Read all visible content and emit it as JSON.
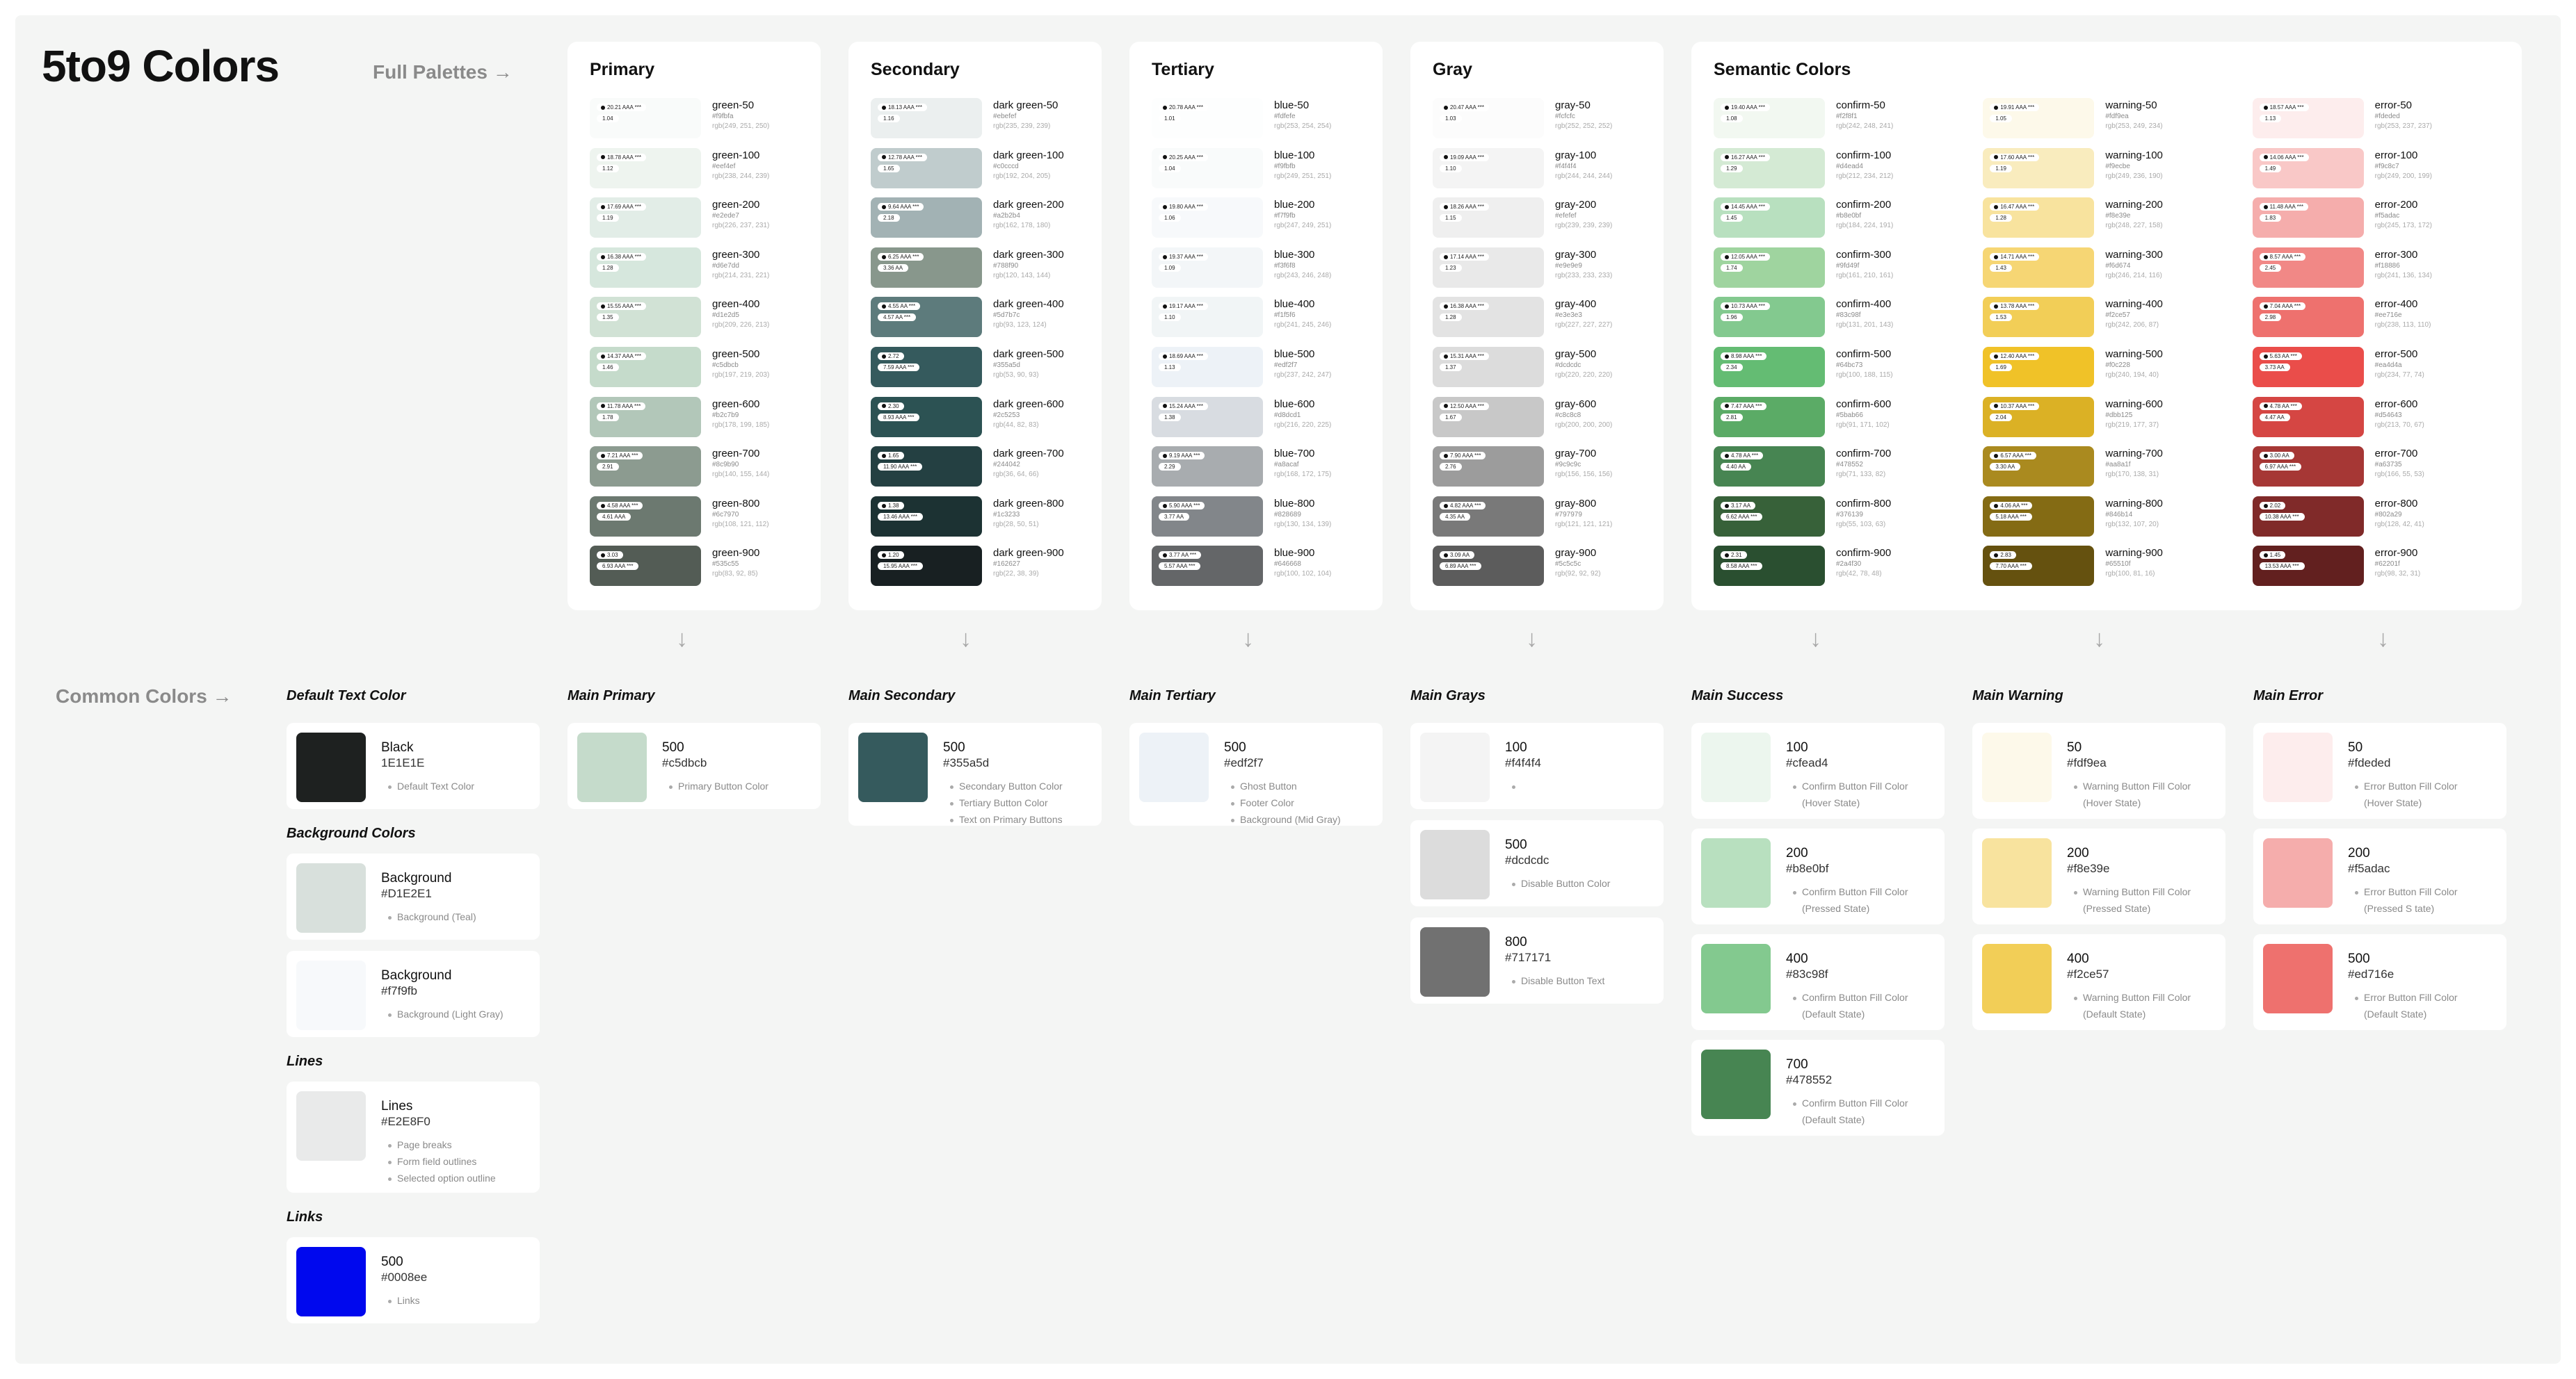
{
  "header": {
    "title": "5to9 Colors",
    "full_palettes": "Full Palettes →",
    "common_colors": "Common Colors →"
  },
  "palettes": [
    {
      "title": "Primary",
      "rows": [
        {
          "name": "green-50",
          "hex": "#f9fbfa",
          "rgb": "rgb(249, 251, 250)",
          "c": "#f9fbfa",
          "p1": "20.21 AAA ***",
          "p2": "1.04"
        },
        {
          "name": "green-100",
          "hex": "#eef4ef",
          "rgb": "rgb(238, 244, 239)",
          "c": "#eef4ef",
          "p1": "18.78 AAA ***",
          "p2": "1.12"
        },
        {
          "name": "green-200",
          "hex": "#e2ede7",
          "rgb": "rgb(226, 237, 231)",
          "c": "#e2ede7",
          "p1": "17.69 AAA ***",
          "p2": "1.19"
        },
        {
          "name": "green-300",
          "hex": "#d6e7dd",
          "rgb": "rgb(214, 231, 221)",
          "c": "#d6e7dd",
          "p1": "16.38 AAA ***",
          "p2": "1.28"
        },
        {
          "name": "green-400",
          "hex": "#d1e2d5",
          "rgb": "rgb(209, 226, 213)",
          "c": "#d1e2d5",
          "p1": "15.55 AAA ***",
          "p2": "1.35"
        },
        {
          "name": "green-500",
          "hex": "#c5dbcb",
          "rgb": "rgb(197, 219, 203)",
          "c": "#c5dbcb",
          "p1": "14.37 AAA ***",
          "p2": "1.46"
        },
        {
          "name": "green-600",
          "hex": "#b2c7b9",
          "rgb": "rgb(178, 199, 185)",
          "c": "#b2c7b9",
          "p1": "11.78 AAA ***",
          "p2": "1.78"
        },
        {
          "name": "green-700",
          "hex": "#8c9b90",
          "rgb": "rgb(140, 155, 144)",
          "c": "#8c9b90",
          "p1": "7.21 AAA ***",
          "p2": "2.91"
        },
        {
          "name": "green-800",
          "hex": "#6c7970",
          "rgb": "rgb(108, 121, 112)",
          "c": "#6c7970",
          "p1": "4.58 AAA ***",
          "p2": "4.61 AAA"
        },
        {
          "name": "green-900",
          "hex": "#535c55",
          "rgb": "rgb(83, 92, 85)",
          "c": "#535c55",
          "p1": "3.03",
          "p2": "6.93 AAA ***"
        }
      ]
    },
    {
      "title": "Secondary",
      "rows": [
        {
          "name": "dark green-50",
          "hex": "#ebefef",
          "rgb": "rgb(235, 239, 239)",
          "c": "#ebefef",
          "p1": "18.13 AAA ***",
          "p2": "1.16"
        },
        {
          "name": "dark green-100",
          "hex": "#c0cccd",
          "rgb": "rgb(192, 204, 205)",
          "c": "#c0cccd",
          "p1": "12.78 AAA ***",
          "p2": "1.65"
        },
        {
          "name": "dark green-200",
          "hex": "#a2b2b4",
          "rgb": "rgb(162, 178, 180)",
          "c": "#a2b2b4",
          "p1": "9.64 AAA ***",
          "p2": "2.18"
        },
        {
          "name": "dark green-300",
          "hex": "#788f90",
          "rgb": "rgb(120, 143, 144)",
          "c": "#88978c",
          "p1": "6.25 AAA ***",
          "p2": "3.36 AA"
        },
        {
          "name": "dark green-400",
          "hex": "#5d7b7c",
          "rgb": "rgb(93, 123, 124)",
          "c": "#5d7b7c",
          "p1": "4.55 AA ***",
          "p2": "4.57 AA ***"
        },
        {
          "name": "dark green-500",
          "hex": "#355a5d",
          "rgb": "rgb(53, 90, 93)",
          "c": "#355a5d",
          "p1": "2.72",
          "p2": "7.59 AAA ***"
        },
        {
          "name": "dark green-600",
          "hex": "#2c5253",
          "rgb": "rgb(44, 82, 83)",
          "c": "#2c5253",
          "p1": "2.30",
          "p2": "8.93 AAA ***"
        },
        {
          "name": "dark green-700",
          "hex": "#244042",
          "rgb": "rgb(36, 64, 66)",
          "c": "#244042",
          "p1": "1.65",
          "p2": "11.90 AAA ***"
        },
        {
          "name": "dark green-800",
          "hex": "#1c3233",
          "rgb": "rgb(28, 50, 51)",
          "c": "#1c3233",
          "p1": "1.38",
          "p2": "13.46 AAA ***"
        },
        {
          "name": "dark green-900",
          "hex": "#162627",
          "rgb": "rgb(22, 38, 39)",
          "c": "#182022",
          "p1": "1.20",
          "p2": "15.95 AAA ***"
        }
      ]
    },
    {
      "title": "Tertiary",
      "rows": [
        {
          "name": "blue-50",
          "hex": "#fdfefe",
          "rgb": "rgb(253, 254, 254)",
          "c": "#fdfefe",
          "p1": "20.78 AAA ***",
          "p2": "1.01"
        },
        {
          "name": "blue-100",
          "hex": "#f9fbfb",
          "rgb": "rgb(249, 251, 251)",
          "c": "#f9fbfb",
          "p1": "20.25 AAA ***",
          "p2": "1.04"
        },
        {
          "name": "blue-200",
          "hex": "#f7f9fb",
          "rgb": "rgb(247, 249, 251)",
          "c": "#f7f9fb",
          "p1": "19.80 AAA ***",
          "p2": "1.06"
        },
        {
          "name": "blue-300",
          "hex": "#f3f6f8",
          "rgb": "rgb(243, 246, 248)",
          "c": "#f3f6f8",
          "p1": "19.37 AAA ***",
          "p2": "1.09"
        },
        {
          "name": "blue-400",
          "hex": "#f1f5f6",
          "rgb": "rgb(241, 245, 246)",
          "c": "#f1f5f6",
          "p1": "19.17 AAA ***",
          "p2": "1.10"
        },
        {
          "name": "blue-500",
          "hex": "#edf2f7",
          "rgb": "rgb(237, 242, 247)",
          "c": "#edf2f7",
          "p1": "18.69 AAA ***",
          "p2": "1.13"
        },
        {
          "name": "blue-600",
          "hex": "#d8dcd1",
          "rgb": "rgb(216, 220, 225)",
          "c": "#d8dce1",
          "p1": "15.24 AAA ***",
          "p2": "1.38"
        },
        {
          "name": "blue-700",
          "hex": "#a8acaf",
          "rgb": "rgb(168, 172, 175)",
          "c": "#a8acaf",
          "p1": "9.19 AAA ***",
          "p2": "2.29"
        },
        {
          "name": "blue-800",
          "hex": "#828689",
          "rgb": "rgb(130, 134, 139)",
          "c": "#82868a",
          "p1": "5.90 AAA ***",
          "p2": "3.77 AA"
        },
        {
          "name": "blue-900",
          "hex": "#646668",
          "rgb": "rgb(100, 102, 104)",
          "c": "#646668",
          "p1": "3.77 AA ***",
          "p2": "5.57 AAA ***"
        }
      ]
    },
    {
      "title": "Gray",
      "rows": [
        {
          "name": "gray-50",
          "hex": "#fcfcfc",
          "rgb": "rgb(252, 252, 252)",
          "c": "#fcfcfc",
          "p1": "20.47 AAA ***",
          "p2": "1.03"
        },
        {
          "name": "gray-100",
          "hex": "#f4f4f4",
          "rgb": "rgb(244, 244, 244)",
          "c": "#f4f4f4",
          "p1": "19.09 AAA ***",
          "p2": "1.10"
        },
        {
          "name": "gray-200",
          "hex": "#efefef",
          "rgb": "rgb(239, 239, 239)",
          "c": "#efefef",
          "p1": "18.26 AAA ***",
          "p2": "1.15"
        },
        {
          "name": "gray-300",
          "hex": "#e9e9e9",
          "rgb": "rgb(233, 233, 233)",
          "c": "#e9e9e9",
          "p1": "17.14 AAA ***",
          "p2": "1.23"
        },
        {
          "name": "gray-400",
          "hex": "#e3e3e3",
          "rgb": "rgb(227, 227, 227)",
          "c": "#e3e3e3",
          "p1": "16.38 AAA ***",
          "p2": "1.28"
        },
        {
          "name": "gray-500",
          "hex": "#dcdcdc",
          "rgb": "rgb(220, 220, 220)",
          "c": "#dcdcdc",
          "p1": "15.31 AAA ***",
          "p2": "1.37"
        },
        {
          "name": "gray-600",
          "hex": "#c8c8c8",
          "rgb": "rgb(200, 200, 200)",
          "c": "#c8c8c8",
          "p1": "12.50 AAA ***",
          "p2": "1.67"
        },
        {
          "name": "gray-700",
          "hex": "#9c9c9c",
          "rgb": "rgb(156, 156, 156)",
          "c": "#9c9c9c",
          "p1": "7.90 AAA ***",
          "p2": "2.76"
        },
        {
          "name": "gray-800",
          "hex": "#797979",
          "rgb": "rgb(121, 121, 121)",
          "c": "#797979",
          "p1": "4.82 AAA ***",
          "p2": "4.35 AA"
        },
        {
          "name": "gray-900",
          "hex": "#5c5c5c",
          "rgb": "rgb(92, 92, 92)",
          "c": "#5c5c5c",
          "p1": "3.09 AA",
          "p2": "6.89 AAA ***"
        }
      ]
    }
  ],
  "semantic": {
    "title": "Semantic Colors",
    "columns": [
      [
        {
          "name": "confirm-50",
          "hex": "#f2f8f1",
          "rgb": "rgb(242, 248, 241)",
          "c": "#f2f8f1",
          "p1": "19.40 AAA ***",
          "p2": "1.08"
        },
        {
          "name": "confirm-100",
          "hex": "#d4ead4",
          "rgb": "rgb(212, 234, 212)",
          "c": "#d4ead4",
          "p1": "16.27 AAA ***",
          "p2": "1.29"
        },
        {
          "name": "confirm-200",
          "hex": "#b8e0bf",
          "rgb": "rgb(184, 224, 191)",
          "c": "#b8e0bf",
          "p1": "14.45 AAA ***",
          "p2": "1.45"
        },
        {
          "name": "confirm-300",
          "hex": "#9fd49f",
          "rgb": "rgb(161, 210, 161)",
          "c": "#9fd49f",
          "p1": "12.05 AAA ***",
          "p2": "1.74"
        },
        {
          "name": "confirm-400",
          "hex": "#83c98f",
          "rgb": "rgb(131, 201, 143)",
          "c": "#83c98f",
          "p1": "10.73 AAA ***",
          "p2": "1.96"
        },
        {
          "name": "confirm-500",
          "hex": "#64bc73",
          "rgb": "rgb(100, 188, 115)",
          "c": "#64bc73",
          "p1": "8.98 AAA ***",
          "p2": "2.34"
        },
        {
          "name": "confirm-600",
          "hex": "#5bab66",
          "rgb": "rgb(91, 171, 102)",
          "c": "#5bab66",
          "p1": "7.47 AAA ***",
          "p2": "2.81"
        },
        {
          "name": "confirm-700",
          "hex": "#478552",
          "rgb": "rgb(71, 133, 82)",
          "c": "#478552",
          "p1": "4.78 AA ***",
          "p2": "4.40 AA"
        },
        {
          "name": "confirm-800",
          "hex": "#376139",
          "rgb": "rgb(55, 103, 63)",
          "c": "#376139",
          "p1": "3.17 AA",
          "p2": "6.62 AAA ***"
        },
        {
          "name": "confirm-900",
          "hex": "#2a4f30",
          "rgb": "rgb(42, 78, 48)",
          "c": "#2a4f30",
          "p1": "2.31",
          "p2": "8.58 AAA ***"
        }
      ],
      [
        {
          "name": "warning-50",
          "hex": "#fdf9ea",
          "rgb": "rgb(253, 249, 234)",
          "c": "#fdf9ea",
          "p1": "19.91 AAA ***",
          "p2": "1.05"
        },
        {
          "name": "warning-100",
          "hex": "#f9ecbe",
          "rgb": "rgb(249, 236, 190)",
          "c": "#f9ecbe",
          "p1": "17.60 AAA ***",
          "p2": "1.19"
        },
        {
          "name": "warning-200",
          "hex": "#f8e39e",
          "rgb": "rgb(248, 227, 158)",
          "c": "#f8e39e",
          "p1": "16.47 AAA ***",
          "p2": "1.28"
        },
        {
          "name": "warning-300",
          "hex": "#f6d674",
          "rgb": "rgb(246, 214, 116)",
          "c": "#f6d674",
          "p1": "14.71 AAA ***",
          "p2": "1.43"
        },
        {
          "name": "warning-400",
          "hex": "#f2ce57",
          "rgb": "rgb(242, 206, 87)",
          "c": "#f2ce57",
          "p1": "13.78 AAA ***",
          "p2": "1.53"
        },
        {
          "name": "warning-500",
          "hex": "#f0c228",
          "rgb": "rgb(240, 194, 40)",
          "c": "#f0c228",
          "p1": "12.40 AAA ***",
          "p2": "1.69"
        },
        {
          "name": "warning-600",
          "hex": "#dbb125",
          "rgb": "rgb(219, 177, 37)",
          "c": "#dbb125",
          "p1": "10.37 AAA ***",
          "p2": "2.04"
        },
        {
          "name": "warning-700",
          "hex": "#aa8a1f",
          "rgb": "rgb(170, 138, 31)",
          "c": "#aa8a1f",
          "p1": "6.57 AAA ***",
          "p2": "3.30 AA"
        },
        {
          "name": "warning-800",
          "hex": "#846b14",
          "rgb": "rgb(132, 107, 20)",
          "c": "#846b14",
          "p1": "4.06 AA ***",
          "p2": "5.18 AAA ***"
        },
        {
          "name": "warning-900",
          "hex": "#65510f",
          "rgb": "rgb(100, 81, 16)",
          "c": "#65510f",
          "p1": "2.83",
          "p2": "7.70 AAA ***"
        }
      ],
      [
        {
          "name": "error-50",
          "hex": "#fdeded",
          "rgb": "rgb(253, 237, 237)",
          "c": "#fdeded",
          "p1": "18.57 AAA ***",
          "p2": "1.13"
        },
        {
          "name": "error-100",
          "hex": "#f9c8c7",
          "rgb": "rgb(249, 200, 199)",
          "c": "#f9c8c7",
          "p1": "14.06 AAA ***",
          "p2": "1.49"
        },
        {
          "name": "error-200",
          "hex": "#f5adac",
          "rgb": "rgb(245, 173, 172)",
          "c": "#f5adac",
          "p1": "11.48 AAA ***",
          "p2": "1.83"
        },
        {
          "name": "error-300",
          "hex": "#f18886",
          "rgb": "rgb(241, 136, 134)",
          "c": "#f18886",
          "p1": "8.57 AAA ***",
          "p2": "2.45"
        },
        {
          "name": "error-400",
          "hex": "#ee716e",
          "rgb": "rgb(238, 113, 110)",
          "c": "#ee716e",
          "p1": "7.04 AAA ***",
          "p2": "2.98"
        },
        {
          "name": "error-500",
          "hex": "#ea4d4a",
          "rgb": "rgb(234, 77, 74)",
          "c": "#ea4d4a",
          "p1": "5.63 AA ***",
          "p2": "3.73 AA"
        },
        {
          "name": "error-600",
          "hex": "#d54643",
          "rgb": "rgb(213, 70, 67)",
          "c": "#d54643",
          "p1": "4.78 AA ***",
          "p2": "4.47 AA"
        },
        {
          "name": "error-700",
          "hex": "#a63735",
          "rgb": "rgb(166, 55, 53)",
          "c": "#a63735",
          "p1": "3.00 AA",
          "p2": "6.97 AAA ***"
        },
        {
          "name": "error-800",
          "hex": "#802a29",
          "rgb": "rgb(128, 42, 41)",
          "c": "#802a29",
          "p1": "2.02",
          "p2": "10.38 AAA ***"
        },
        {
          "name": "error-900",
          "hex": "#62201f",
          "rgb": "rgb(98, 32, 31)",
          "c": "#62201f",
          "p1": "1.45",
          "p2": "13.53 AAA ***"
        }
      ]
    ]
  },
  "common": {
    "default_text": {
      "label": "Default Text Color",
      "cards": [
        {
          "name": "Black",
          "hex": "1E1E1E",
          "c": "#1e2120",
          "notes": [
            "Default Text Color"
          ]
        }
      ]
    },
    "background": {
      "label": "Background Colors",
      "cards": [
        {
          "name": "Background",
          "hex": "#D1E2E1",
          "c": "#d8e0dc",
          "notes": [
            "Background (Teal)"
          ]
        },
        {
          "name": "Background",
          "hex": "#f7f9fb",
          "c": "#f7f9fb",
          "notes": [
            "Background (Light Gray)"
          ]
        }
      ]
    },
    "lines": {
      "label": "Lines",
      "cards": [
        {
          "name": "Lines",
          "hex": "#E2E8F0",
          "c": "#e9eaea",
          "notes": [
            "Page breaks",
            "Form field outlines",
            "Selected option outline"
          ]
        }
      ]
    },
    "links": {
      "label": "Links",
      "cards": [
        {
          "name": "500",
          "hex": "#0008ee",
          "c": "#0008ee",
          "notes": [
            "Links"
          ]
        }
      ]
    },
    "groups": [
      {
        "label": "Main Primary",
        "cards": [
          {
            "name": "500",
            "hex": "#c5dbcb",
            "c": "#c5dbcb",
            "notes": [
              "Primary Button Color"
            ]
          }
        ]
      },
      {
        "label": "Main Secondary",
        "cards": [
          {
            "name": "500",
            "hex": "#355a5d",
            "c": "#355a5d",
            "notes": [
              "Secondary Button Color",
              "Tertiary Button Color",
              "Text on Primary Buttons"
            ]
          }
        ]
      },
      {
        "label": "Main Tertiary",
        "cards": [
          {
            "name": "500",
            "hex": "#edf2f7",
            "c": "#edf2f7",
            "notes": [
              "Ghost Button",
              "Footer Color",
              "Background (Mid Gray)"
            ]
          }
        ]
      },
      {
        "label": "Main Grays",
        "cards": [
          {
            "name": "100",
            "hex": "#f4f4f4",
            "c": "#f4f4f4",
            "notes": [
              ""
            ]
          },
          {
            "name": "500",
            "hex": "#dcdcdc",
            "c": "#dcdcdc",
            "notes": [
              "Disable Button Color"
            ]
          },
          {
            "name": "800",
            "hex": "#717171",
            "c": "#717171",
            "notes": [
              "Disable Button Text"
            ]
          }
        ]
      },
      {
        "label": "Main Success",
        "cards": [
          {
            "name": "100",
            "hex": "#cfead4",
            "c": "#ecf6ee",
            "notes": [
              "Confirm Button Fill Color",
              "(Hover State)"
            ]
          },
          {
            "name": "200",
            "hex": "#b8e0bf",
            "c": "#b8e0bf",
            "notes": [
              "Confirm Button Fill Color",
              "(Pressed State)"
            ]
          },
          {
            "name": "400",
            "hex": "#83c98f",
            "c": "#83c98f",
            "notes": [
              "Confirm Button Fill Color",
              "(Default State)"
            ]
          },
          {
            "name": "700",
            "hex": "#478552",
            "c": "#478552",
            "notes": [
              "Confirm Button Fill Color",
              "(Default State)"
            ]
          }
        ]
      },
      {
        "label": "Main Warning",
        "cards": [
          {
            "name": "50",
            "hex": "#fdf9ea",
            "c": "#fdf9ea",
            "notes": [
              "Warning Button Fill Color",
              "(Hover State)"
            ]
          },
          {
            "name": "200",
            "hex": "#f8e39e",
            "c": "#f8e39e",
            "notes": [
              "Warning Button Fill Color",
              "(Pressed State)"
            ]
          },
          {
            "name": "400",
            "hex": "#f2ce57",
            "c": "#f2ce57",
            "notes": [
              "Warning Button Fill Color",
              "(Default State)"
            ]
          }
        ]
      },
      {
        "label": "Main Error",
        "cards": [
          {
            "name": "50",
            "hex": "#fdeded",
            "c": "#fdeded",
            "notes": [
              "Error Button Fill Color",
              "(Hover State)"
            ]
          },
          {
            "name": "200",
            "hex": "#f5adac",
            "c": "#f5adac",
            "notes": [
              "Error Button Fill Color",
              "(Pressed S tate)"
            ]
          },
          {
            "name": "500",
            "hex": "#ed716e",
            "c": "#ee716e",
            "notes": [
              "Error Button Fill Color",
              "(Default State)"
            ]
          }
        ]
      }
    ]
  }
}
